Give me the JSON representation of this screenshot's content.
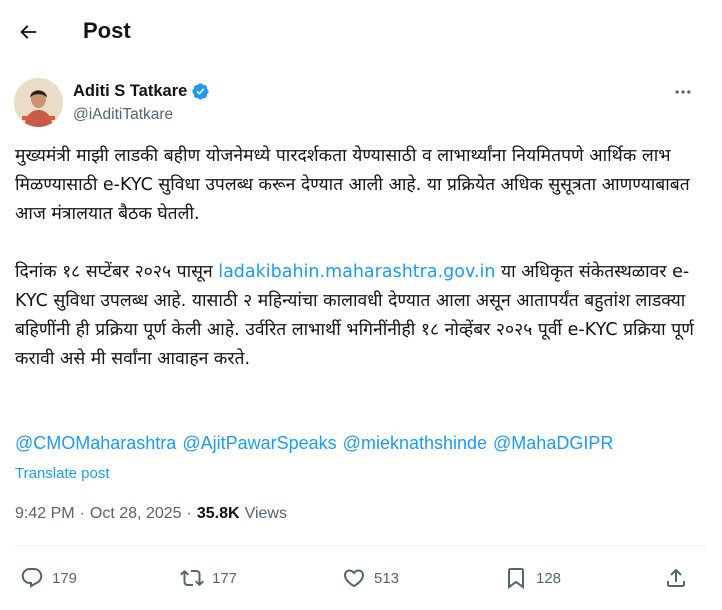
{
  "header": {
    "title": "Post",
    "back_icon": "arrow-left-icon"
  },
  "author": {
    "name": "Aditi S Tatkare",
    "handle": "@iAditiTatkare",
    "verified_color": "#1d9bf0"
  },
  "post": {
    "paragraph1": "मुख्यमंत्री माझी लाडकी बहीण योजनेमध्ये पारदर्शकता येण्यासाठी व लाभार्थ्यांना नियमितपणे आर्थिक लाभ मिळण्यासाठी e-KYC सुविधा उपलब्ध करून देण्यात आली आहे. या प्रक्रियेत अधिक सुसूत्रता आणण्याबाबत आज मंत्रालयात बैठक घेतली.",
    "paragraph2_before_link": "दिनांक १८ सप्टेंबर २०२५ पासून ",
    "link": "ladakibahin.maharashtra.gov.in",
    "paragraph2_after_link": " या अधिकृत संकेतस्थळावर e-KYC सुविधा उपलब्ध आहे. यासाठी २ महिन्यांचा कालावधी देण्यात आला असून आतापर्यंत बहुतांश लाडक्या बहिणींनी ही प्रक्रिया पूर्ण केली आहे. उर्वरित लाभार्थी भगिनींनीही १८ नोव्हेंबर २०२५ पूर्वी e-KYC प्रक्रिया पूर्ण करावी असे मी सर्वांना आवाहन करते.",
    "mentions": [
      "@CMOMaharashtra",
      "@AjitPawarSpeaks",
      "@mieknathshinde",
      "@MahaDGIPR"
    ],
    "translate_label": "Translate post"
  },
  "meta": {
    "time": "9:42 PM",
    "separator1": "·",
    "date": "Oct 28, 2025",
    "separator2": "·",
    "views_count": "35.8K",
    "views_label": "Views"
  },
  "actions": {
    "replies": "179",
    "reposts": "177",
    "likes": "513",
    "bookmarks": "128"
  },
  "colors": {
    "accent": "#1d9bf0",
    "muted": "#536471",
    "text": "#0f1419"
  }
}
